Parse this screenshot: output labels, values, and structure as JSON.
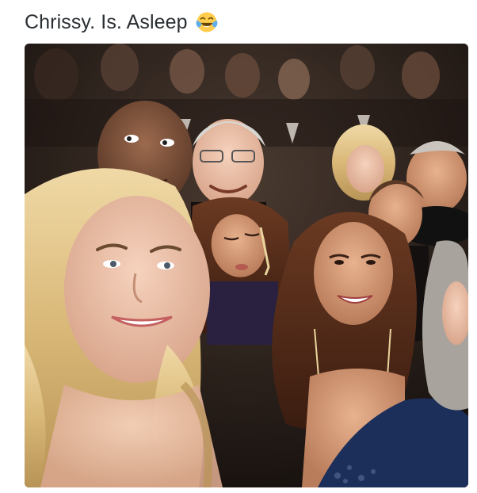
{
  "tweet": {
    "text": "Chrissy. Is. Asleep",
    "emoji": "face-with-tears-of-joy-icon"
  },
  "photo": {
    "subject": "crowd-selfie-photo"
  },
  "colors": {
    "text": "#292f33",
    "background": "#ffffff"
  }
}
